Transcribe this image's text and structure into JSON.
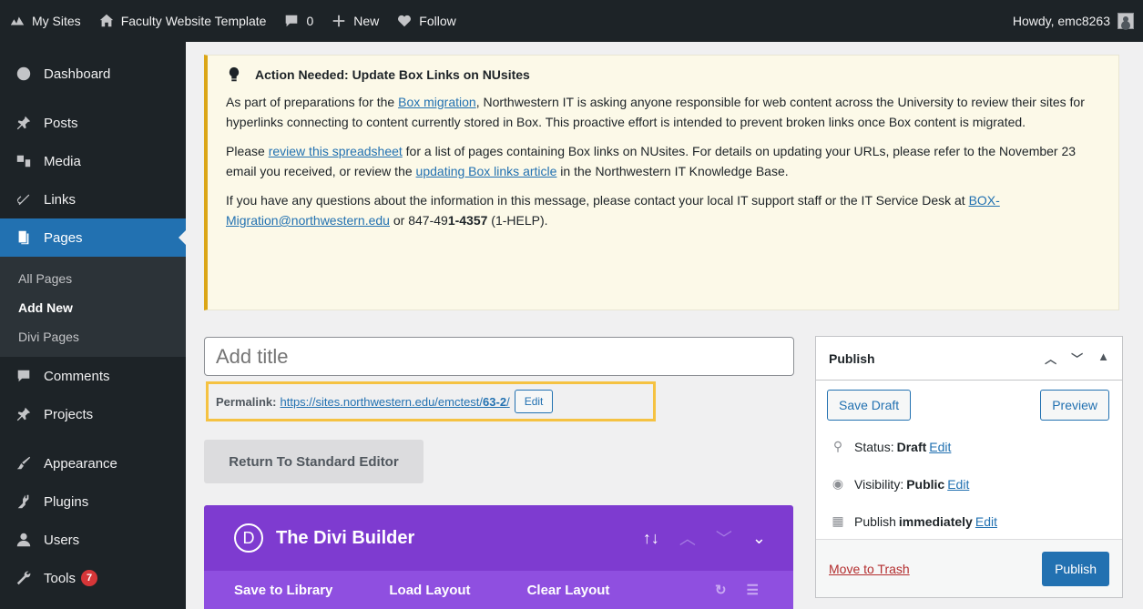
{
  "adminbar": {
    "my_sites": "My Sites",
    "site_name": "Faculty Website Template",
    "comments_count": "0",
    "new_label": "New",
    "follow_label": "Follow",
    "howdy": "Howdy, emc8263"
  },
  "sidebar": {
    "dashboard": "Dashboard",
    "posts": "Posts",
    "media": "Media",
    "links": "Links",
    "pages": "Pages",
    "sub_all": "All Pages",
    "sub_add": "Add New",
    "sub_divi": "Divi Pages",
    "comments": "Comments",
    "projects": "Projects",
    "appearance": "Appearance",
    "plugins": "Plugins",
    "users": "Users",
    "tools": "Tools",
    "tools_badge": "7"
  },
  "notice": {
    "title": "Action Needed: Update Box Links on NUsites",
    "p1_before": "As part of preparations for the ",
    "p1_link": "Box migration",
    "p1_after": ", Northwestern IT is asking anyone responsible for web content across the University to review their sites for hyperlinks connecting to content currently stored in Box. This proactive effort is intended to prevent broken links once Box content is migrated.",
    "p2_before": "Please ",
    "p2_link1": "review this spreadsheet",
    "p2_mid": " for a list of pages containing Box links on NUsites. For details on updating your URLs, please refer to the November 23 email you received, or review the ",
    "p2_link2": "updating Box links article",
    "p2_after": " in the Northwestern IT Knowledge Base.",
    "p3_before": "If you have any questions about the information in this message, please contact your local IT support staff or the IT Service Desk at ",
    "p3_email": "BOX-Migration@northwestern.edu",
    "p3_mid": " or 847-49",
    "p3_bold": "1-4357",
    "p3_after": " (1-HELP)."
  },
  "editor": {
    "title_placeholder": "Add title",
    "permalink_label": "Permalink:",
    "permalink_base": "https://sites.northwestern.edu/emctest/",
    "permalink_slug": "63-2",
    "permalink_trail": "/",
    "permalink_edit": "Edit",
    "standard_editor": "Return To Standard Editor"
  },
  "divi": {
    "logo": "D",
    "title": "The Divi Builder",
    "save_library": "Save to Library",
    "load_layout": "Load Layout",
    "clear_layout": "Clear Layout"
  },
  "publish": {
    "heading": "Publish",
    "save_draft": "Save Draft",
    "preview": "Preview",
    "status_label": "Status:",
    "status_value": "Draft",
    "visibility_label": "Visibility:",
    "visibility_value": "Public",
    "publish_label": "Publish",
    "publish_value": "immediately",
    "edit": "Edit",
    "move_trash": "Move to Trash",
    "publish_btn": "Publish"
  },
  "colors": {
    "admin_dark": "#1d2327",
    "accent_blue": "#2271b1",
    "notice_yellow": "#dba617",
    "divi_purple": "#7e3bd0",
    "highlight": "#f5c242"
  }
}
